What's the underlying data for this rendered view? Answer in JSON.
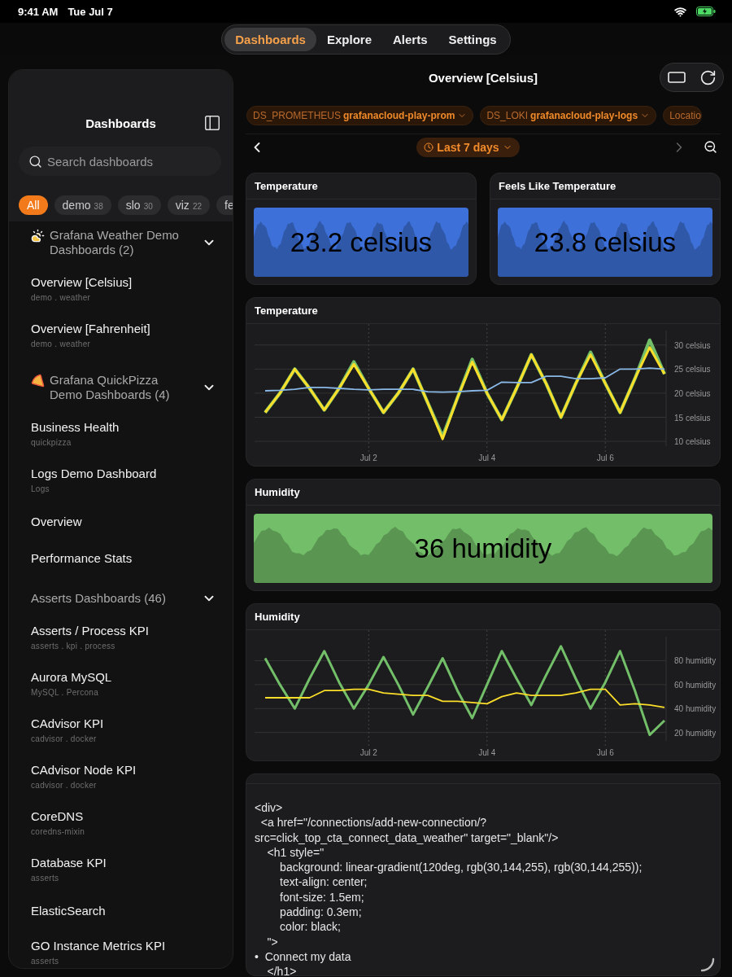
{
  "status_bar": {
    "time": "9:41 AM",
    "date": "Tue Jul 7"
  },
  "nav_tabs": [
    {
      "label": "Dashboards",
      "selected": true
    },
    {
      "label": "Explore",
      "selected": false
    },
    {
      "label": "Alerts",
      "selected": false
    },
    {
      "label": "Settings",
      "selected": false
    }
  ],
  "sidebar": {
    "title": "Dashboards",
    "search": {
      "placeholder": "Search dashboards"
    },
    "filters": [
      {
        "label": "All",
        "selected": true
      },
      {
        "label": "demo",
        "count": "38",
        "selected": false
      },
      {
        "label": "slo",
        "count": "30",
        "selected": false
      },
      {
        "label": "viz",
        "count": "22",
        "selected": false
      },
      {
        "label": "fe",
        "selected": false
      }
    ],
    "groups": [
      {
        "title": "Grafana Weather Demo Dashboards (2)",
        "expanded": true,
        "items": [
          {
            "title": "Overview [Celsius]",
            "tags": "demo . weather"
          },
          {
            "title": "Overview [Fahrenheit]",
            "tags": "demo . weather"
          }
        ]
      },
      {
        "title": "Grafana QuickPizza Demo Dashboards (4)",
        "expanded": true,
        "items": [
          {
            "title": "Business Health",
            "tags": "quickpizza"
          },
          {
            "title": "Logs Demo Dashboard",
            "tags": "Logs"
          },
          {
            "title": "Overview"
          },
          {
            "title": "Performance Stats"
          }
        ]
      },
      {
        "title": "Asserts Dashboards (46)",
        "expanded": true,
        "items": [
          {
            "title": "Asserts / Process KPI",
            "tags": "asserts . kpi . process"
          },
          {
            "title": "Aurora MySQL",
            "tags": "MySQL . Percona"
          },
          {
            "title": "CAdvisor KPI",
            "tags": "cadvisor . docker"
          },
          {
            "title": "CAdvisor Node KPI",
            "tags": "cadvisor . docker"
          },
          {
            "title": "CoreDNS",
            "tags": "coredns-mixin"
          },
          {
            "title": "Database KPI",
            "tags": "asserts"
          },
          {
            "title": "ElasticSearch"
          },
          {
            "title": "GO Instance Metrics KPI",
            "tags": "asserts"
          }
        ]
      }
    ]
  },
  "dashboard": {
    "title": "Overview [Celsius]",
    "variables": [
      {
        "name": "DS_PROMETHEUS",
        "value": "grafanacloud-play-prom"
      },
      {
        "name": "DS_LOKI",
        "value": "grafanacloud-play-logs"
      },
      {
        "name": "Locatio"
      }
    ],
    "time_range": {
      "label": "Last 7 days",
      "next_disabled": true
    },
    "rows": [
      {
        "panels": [
          {
            "kind": "stat",
            "title": "Temperature",
            "value": "23.2 celsius",
            "color": "#3d71d9"
          },
          {
            "kind": "stat",
            "title": "Feels Like Temperature",
            "value": "23.8 celsius",
            "color": "#3d71d9"
          }
        ]
      },
      {
        "panels": [
          {
            "kind": "timeseries",
            "title": "Temperature",
            "chart_data": {
              "type": "line",
              "categories": [
                null,
                null,
                null,
                null,
                null,
                null,
                null,
                "Jul 2",
                null,
                null,
                null,
                null,
                null,
                null,
                null,
                "Jul 4",
                null,
                null,
                null,
                null,
                null,
                null,
                null,
                "Jul 6",
                null,
                null,
                null,
                null
              ],
              "ylim": [
                9,
                33
              ],
              "series": [
                {
                  "color": "#73bf69",
                  "values": [
                    16,
                    20,
                    25,
                    21,
                    16.5,
                    21,
                    26.5,
                    21,
                    16,
                    20,
                    25,
                    18,
                    11,
                    19,
                    27,
                    20,
                    14.5,
                    21,
                    28,
                    22,
                    15,
                    22,
                    28.5,
                    22,
                    16,
                    23,
                    31,
                    24
                  ]
                },
                {
                  "color": "#fade2a",
                  "values": [
                    16,
                    20,
                    25,
                    21,
                    16.5,
                    21,
                    26,
                    21,
                    16,
                    20,
                    25,
                    18,
                    10.5,
                    19,
                    26.5,
                    20,
                    14.5,
                    21,
                    28,
                    22,
                    15,
                    22,
                    28,
                    22,
                    16,
                    23,
                    29.5,
                    24
                  ]
                },
                {
                  "color": "#8ab8e6",
                  "values": [
                    20.5,
                    20.6,
                    20.8,
                    21.2,
                    21.2,
                    21,
                    20.8,
                    20.7,
                    20.8,
                    20.8,
                    20.8,
                    20.3,
                    20.2,
                    20.3,
                    20.5,
                    20.6,
                    22.3,
                    22.2,
                    22.2,
                    23.5,
                    23.5,
                    23,
                    23,
                    23.2,
                    25,
                    25,
                    25.2,
                    25
                  ]
                }
              ],
              "grid": true,
              "yticks": [
                {
                  "value": 10,
                  "label": "10 celsius"
                },
                {
                  "value": 15,
                  "label": "15 celsius"
                },
                {
                  "value": 20,
                  "label": "20 celsius"
                },
                {
                  "value": 25,
                  "label": "25 celsius"
                },
                {
                  "value": 30,
                  "label": "30 celsius"
                }
              ]
            }
          }
        ]
      },
      {
        "panels": [
          {
            "kind": "stat",
            "title": "Humidity",
            "value": "36 humidity",
            "color": "#73bf69"
          }
        ]
      },
      {
        "panels": [
          {
            "kind": "timeseries",
            "title": "Humidity",
            "chart_data": {
              "type": "line",
              "categories": [
                null,
                null,
                null,
                null,
                null,
                null,
                null,
                "Jul 2",
                null,
                null,
                null,
                null,
                null,
                null,
                null,
                "Jul 4",
                null,
                null,
                null,
                null,
                null,
                null,
                null,
                "Jul 6",
                null,
                null,
                null,
                null
              ],
              "ylim": [
                13,
                100
              ],
              "series": [
                {
                  "color": "#73bf69",
                  "values": [
                    82,
                    60,
                    40,
                    65,
                    88,
                    62,
                    40,
                    60,
                    83,
                    60,
                    35,
                    58,
                    82,
                    55,
                    32,
                    60,
                    88,
                    65,
                    43,
                    68,
                    92,
                    65,
                    40,
                    62,
                    88,
                    55,
                    18,
                    30
                  ]
                },
                {
                  "color": "#fade2a",
                  "values": [
                    49,
                    49,
                    49,
                    49,
                    55,
                    55,
                    56,
                    56,
                    53,
                    52,
                    51,
                    51,
                    46,
                    46,
                    45,
                    44,
                    50,
                    53,
                    51,
                    51,
                    51,
                    53,
                    56,
                    56,
                    43,
                    44,
                    43,
                    41
                  ]
                }
              ],
              "grid": true,
              "yticks": [
                {
                  "value": 20,
                  "label": "20 humidity"
                },
                {
                  "value": 40,
                  "label": "40 humidity"
                },
                {
                  "value": 60,
                  "label": "60 humidity"
                },
                {
                  "value": 80,
                  "label": "80 humidity"
                }
              ]
            }
          }
        ]
      },
      {
        "panels": [
          {
            "kind": "text",
            "lines": [
              "<div>",
              "  <a href=\"/connections/add-new-connection/?",
              "src=click_top_cta_connect_data_weather\" target=\"_blank\"/>",
              "    <h1 style=\"",
              "        background: linear-gradient(120deg, rgb(30,144,255), rgb(30,144,255));",
              "        text-align: center;",
              "        font-size: 1.5em;",
              "        padding: 0.3em;",
              "        color: black;",
              "    \">",
              "•  Connect my data",
              "    </h1>"
            ]
          }
        ]
      }
    ]
  }
}
